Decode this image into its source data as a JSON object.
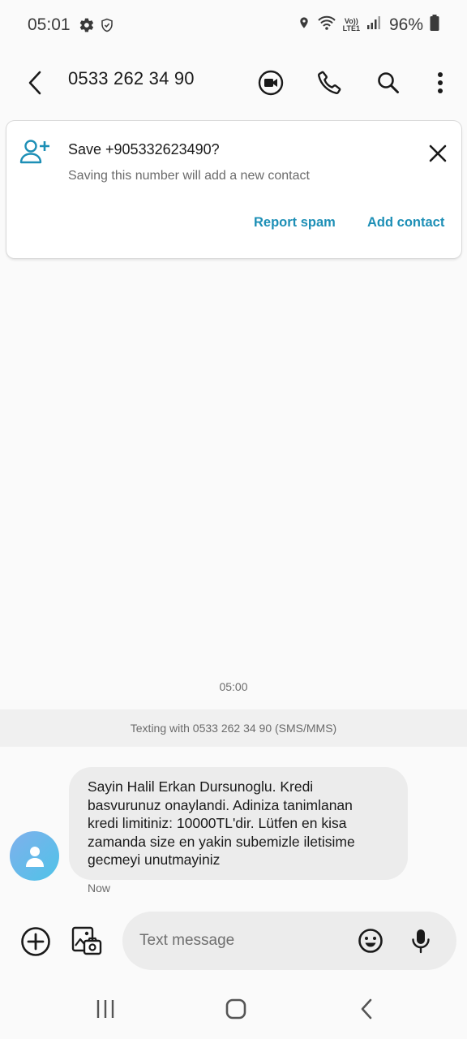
{
  "status_bar": {
    "time": "05:01",
    "battery": "96%",
    "icons": [
      "settings-icon",
      "shield-check-icon",
      "location-icon",
      "wifi-icon",
      "volte-lte-icon",
      "signal-icon",
      "battery-icon"
    ],
    "volte_top": "Vo))",
    "volte_bottom": "LTE1"
  },
  "app_bar": {
    "title": "0533 262 34 90",
    "actions": [
      "video-call-icon",
      "phone-icon",
      "search-icon",
      "more-vert-icon"
    ]
  },
  "save_card": {
    "title": "Save +905332623490?",
    "subtitle": "Saving this number will add a new contact",
    "report_spam_label": "Report spam",
    "add_contact_label": "Add contact"
  },
  "conversation": {
    "date_stamp": "05:00",
    "texting_with": "Texting with 0533 262 34 90 (SMS/MMS)",
    "messages": [
      {
        "lines": [
          "Sayin Halil Erkan Dursunoglu. Kredi",
          "basvurunuz onaylandi. Adiniza tanimlanan",
          "kredi limitiniz: 10000TL'dir. Lütfen en kisa",
          "zamanda size en yakin subemizle iletisime",
          "gecmeyi unutmayiniz"
        ],
        "time": "Now"
      }
    ]
  },
  "composer": {
    "placeholder": "Text message"
  },
  "colors": {
    "accent": "#1d8fb6",
    "background": "#fafafa",
    "bubble": "#ececec",
    "avatar_gradient": [
      "#7fb0ec",
      "#4fc3e8"
    ]
  }
}
